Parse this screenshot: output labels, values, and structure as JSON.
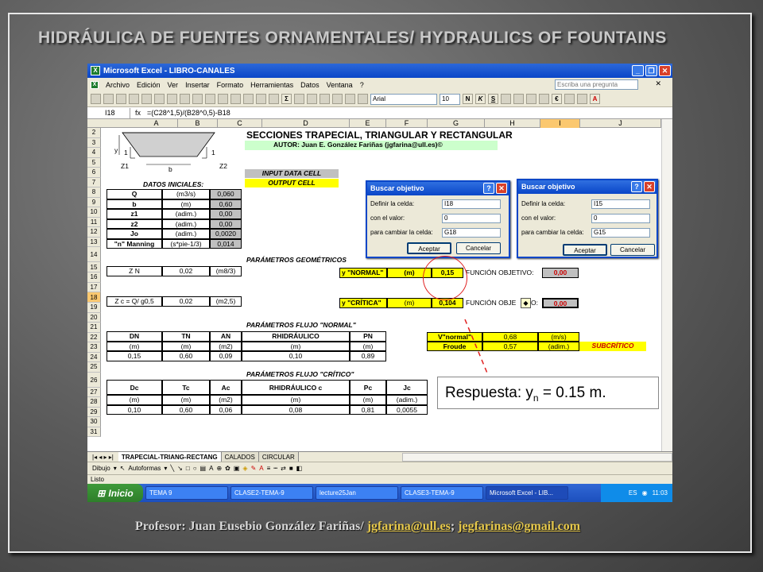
{
  "slide": {
    "title": "HIDRÁULICA DE FUENTES ORNAMENTALES/ HYDRAULICS OF FOUNTAINS",
    "footer_prefix": "Profesor: Juan Eusebio González Fariñas/ ",
    "footer_email1": "jgfarina@ull.es",
    "footer_sep": "; ",
    "footer_email2": "jegfarinas@gmail.com"
  },
  "excel": {
    "title": "Microsoft Excel - LIBRO-CANALES",
    "menu": [
      "Archivo",
      "Edición",
      "Ver",
      "Insertar",
      "Formato",
      "Herramientas",
      "Datos",
      "Ventana",
      "?"
    ],
    "help_placeholder": "Escriba una pregunta",
    "font": "Arial",
    "font_size": "10",
    "namebox": "I18",
    "formula": "=(C28^1,5)/(B28^0,5)-B18",
    "columns": [
      "A",
      "B",
      "C",
      "D",
      "E",
      "F",
      "G",
      "H",
      "I",
      "J"
    ],
    "rows": [
      "2",
      "3",
      "4",
      "5",
      "6",
      "7",
      "8",
      "9",
      "10",
      "11",
      "12",
      "13",
      "14",
      "15",
      "16",
      "17",
      "18",
      "19",
      "20",
      "21",
      "22",
      "23",
      "24",
      "25",
      "26",
      "27",
      "28",
      "29",
      "30",
      "31"
    ],
    "sheet_title": "SECCIONES TRAPECIAL, TRIANGULAR Y RECTANGULAR",
    "author": "AUTOR: Juan E. González Fariñas (jgfarina@ull.es)©",
    "input_label": "INPUT  DATA CELL",
    "output_label": "OUTPUT  CELL",
    "diagram": {
      "y": "y",
      "z1": "Z1",
      "z2": "Z2",
      "b": "b",
      "one_left": "1",
      "one_right": "1"
    },
    "datos_header": "DATOS INICIALES:",
    "datos": [
      {
        "name": "Q",
        "unit": "(m3/s)",
        "value": "0,060"
      },
      {
        "name": "b",
        "unit": "(m)",
        "value": "0,60"
      },
      {
        "name": "z1",
        "unit": "(adim.)",
        "value": "0,00"
      },
      {
        "name": "z2",
        "unit": "(adim.)",
        "value": "0,00"
      },
      {
        "name": "Jo",
        "unit": "(adim.)",
        "value": "0,0020"
      },
      {
        "name": "\"n\" Manning",
        "unit": "(s*pie-1/3)",
        "value": "0,014"
      }
    ],
    "param_geo": "PARÁMETROS GEOMÉTRICOS",
    "row15": {
      "label": "Z N",
      "value": "0,02",
      "unit": "(m8/3)"
    },
    "row18": {
      "label": "Z c = Q/ g0,5",
      "value": "0,02",
      "unit": "(m2,5)"
    },
    "yn": {
      "label": "y \"NORMAL\"",
      "unit": "(m)",
      "value": "0,15",
      "fo": "FUNCIÓN OBJETIVO:",
      "fo_value": "0,00"
    },
    "yc": {
      "label": "y \"CRÍTICA\"",
      "unit": "(m)",
      "value": "0,104",
      "fo": "FUNCIÓN OBJE",
      "fo_tail": "O:",
      "fo_value": "0,00"
    },
    "flujo_normal": {
      "title": "PARÁMETROS FLUJO \"NORMAL\"",
      "headers": [
        "DN",
        "TN",
        "AN",
        "RHIDRÁULICO",
        "PN"
      ],
      "units": [
        "(m)",
        "(m)",
        "(m2)",
        "(m)",
        "(m)"
      ],
      "values": [
        "0,15",
        "0,60",
        "0,09",
        "0,10",
        "0,89"
      ]
    },
    "vel": {
      "label": "V\"normal\"",
      "value": "0,68",
      "unit": "(m/s)"
    },
    "froude": {
      "label": "Froude",
      "value": "0,57",
      "unit": "(adim.)",
      "regime": "SUBCRÍTICO"
    },
    "flujo_critico": {
      "title": "PARÁMETROS FLUJO \"CRÍTICO\"",
      "headers": [
        "Dc",
        "Tc",
        "Ac",
        "RHIDRÁULICO c",
        "Pc",
        "Jc"
      ],
      "units": [
        "(m)",
        "(m)",
        "(m2)",
        "(m)",
        "(m)",
        "(adim.)"
      ],
      "values": [
        "0,10",
        "0,60",
        "0,06",
        "0,08",
        "0,81",
        "0,0055"
      ]
    },
    "dialog1": {
      "title": "Buscar objetivo",
      "lbl_cell": "Definir la celda:",
      "val_cell": "I18",
      "lbl_value": "con el valor:",
      "val_value": "0",
      "lbl_change": "para cambiar la celda:",
      "val_change": "G18",
      "ok": "Aceptar",
      "cancel": "Cancelar"
    },
    "dialog2": {
      "title": "Buscar objetivo",
      "lbl_cell": "Definir la celda:",
      "val_cell": "I15",
      "lbl_value": "con el valor:",
      "val_value": "0",
      "lbl_change": "para cambiar la celda:",
      "val_change": "G15",
      "ok": "Aceptar",
      "cancel": "Cancelar"
    },
    "tabs": [
      "TRAPECIAL-TRIANG-RECTANG",
      "CALADOS",
      "CIRCULAR"
    ],
    "draw_label": "Dibujo",
    "autoformas": "Autoformas",
    "status": "Listo",
    "taskbar": {
      "start": "Inicio",
      "items": [
        "TEMA 9",
        "CLASE2-TEMA-9",
        "lecture25Jan",
        "CLASE3-TEMA-9",
        "Microsoft Excel - LIB..."
      ],
      "lang": "ES",
      "time": "11:03"
    }
  },
  "answer": {
    "prefix": "Respuesta: y",
    "sub": "n",
    "suffix": " = 0.15 m."
  },
  "colors": {
    "title_blue": "#0a46c8",
    "yellow": "#ffff00",
    "highlight": "#e02020",
    "taskbar": "#245edb"
  }
}
